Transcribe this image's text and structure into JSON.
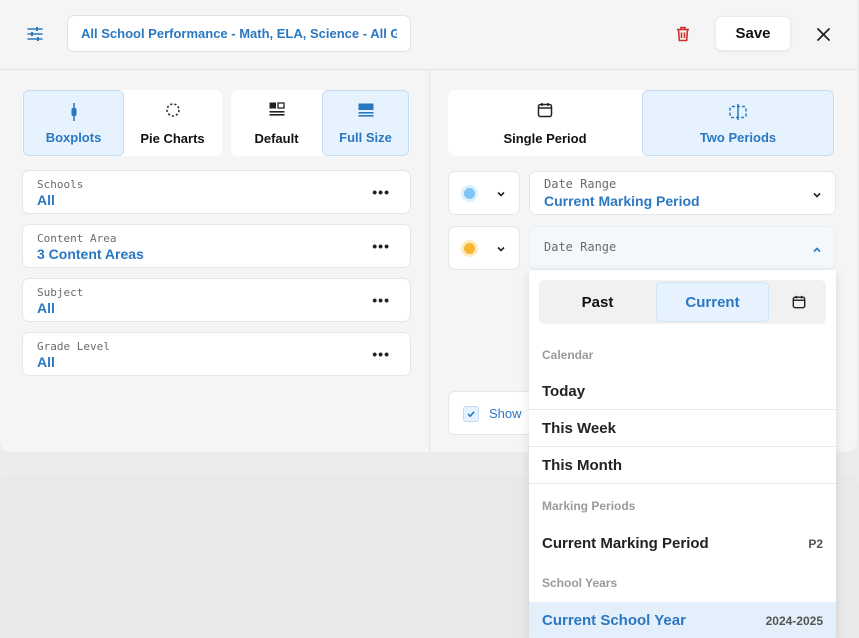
{
  "header": {
    "title_value": "All School Performance - Math, ELA, Science - All Grades",
    "save_label": "Save"
  },
  "chart_type": {
    "options": [
      {
        "label": "Boxplots",
        "icon": "boxplot-icon",
        "active": true
      },
      {
        "label": "Pie Charts",
        "icon": "pie-chart-icon",
        "active": false
      }
    ]
  },
  "size_mode": {
    "options": [
      {
        "label": "Default",
        "icon": "default-layout-icon",
        "active": false
      },
      {
        "label": "Full Size",
        "icon": "full-size-icon",
        "active": true
      }
    ]
  },
  "period_mode": {
    "options": [
      {
        "label": "Single Period",
        "icon": "calendar-icon",
        "active": false
      },
      {
        "label": "Two Periods",
        "icon": "split-icon",
        "active": true
      }
    ]
  },
  "filters": [
    {
      "label": "Schools",
      "value": "All"
    },
    {
      "label": "Content Area",
      "value": "3 Content Areas"
    },
    {
      "label": "Subject",
      "value": "All"
    },
    {
      "label": "Grade Level",
      "value": "All"
    }
  ],
  "periods": [
    {
      "color": "#7cc4f4",
      "label": "Date Range",
      "value": "Current Marking Period"
    },
    {
      "color": "#f7b733",
      "label": "Date Range",
      "value": ""
    }
  ],
  "show_label": "Show",
  "dropdown": {
    "tabs": [
      "Past",
      "Current"
    ],
    "active_tab": "Current",
    "sections": [
      {
        "heading": "Calendar",
        "items": [
          {
            "label": "Today",
            "right": ""
          },
          {
            "label": "This Week",
            "right": ""
          },
          {
            "label": "This Month",
            "right": ""
          }
        ]
      },
      {
        "heading": "Marking Periods",
        "items": [
          {
            "label": "Current Marking Period",
            "right": "P2"
          }
        ]
      },
      {
        "heading": "School Years",
        "items": [
          {
            "label": "Current School Year",
            "right": "2024-2025",
            "selected": true
          }
        ]
      }
    ]
  },
  "colors": {
    "accent": "#2b78c2",
    "accent_bg": "#e6f2fd",
    "danger": "#d32f2f"
  }
}
